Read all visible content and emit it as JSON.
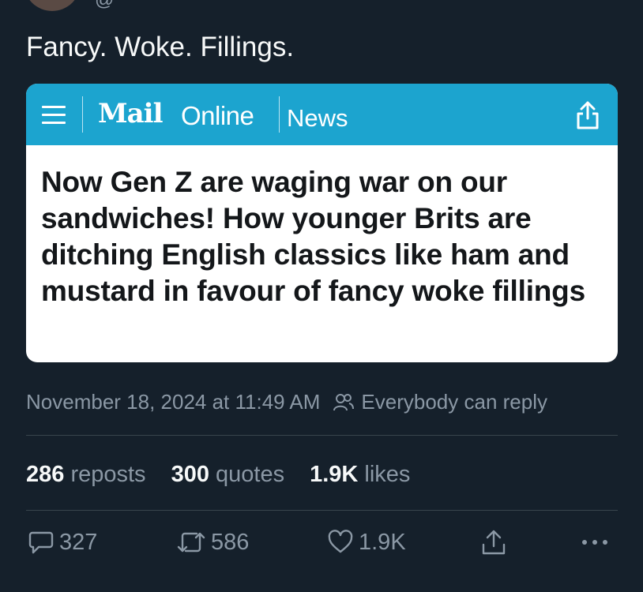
{
  "tweet": {
    "text": "Fancy. Woke. Fillings.",
    "handle_partial": "@"
  },
  "card": {
    "brand_mail": "Mail",
    "brand_online": "Online",
    "section": "News",
    "headline": "Now Gen Z are waging war on our sandwiches! How younger Brits are ditching English classics like ham and mustard in favour of fancy woke fillings",
    "bar_color": "#1ca4cf"
  },
  "meta": {
    "timestamp": "November 18, 2024 at 11:49 AM",
    "reply_setting": "Everybody can reply"
  },
  "stats": {
    "reposts_count": "286",
    "reposts_label": "reposts",
    "quotes_count": "300",
    "quotes_label": "quotes",
    "likes_count": "1.9K",
    "likes_label": "likes"
  },
  "actions": {
    "replies": "327",
    "retweets": "586",
    "likes": "1.9K"
  },
  "icons": [
    "menu-icon",
    "share-icon",
    "people-icon",
    "reply-icon",
    "retweet-icon",
    "heart-icon",
    "share-icon",
    "more-icon"
  ]
}
